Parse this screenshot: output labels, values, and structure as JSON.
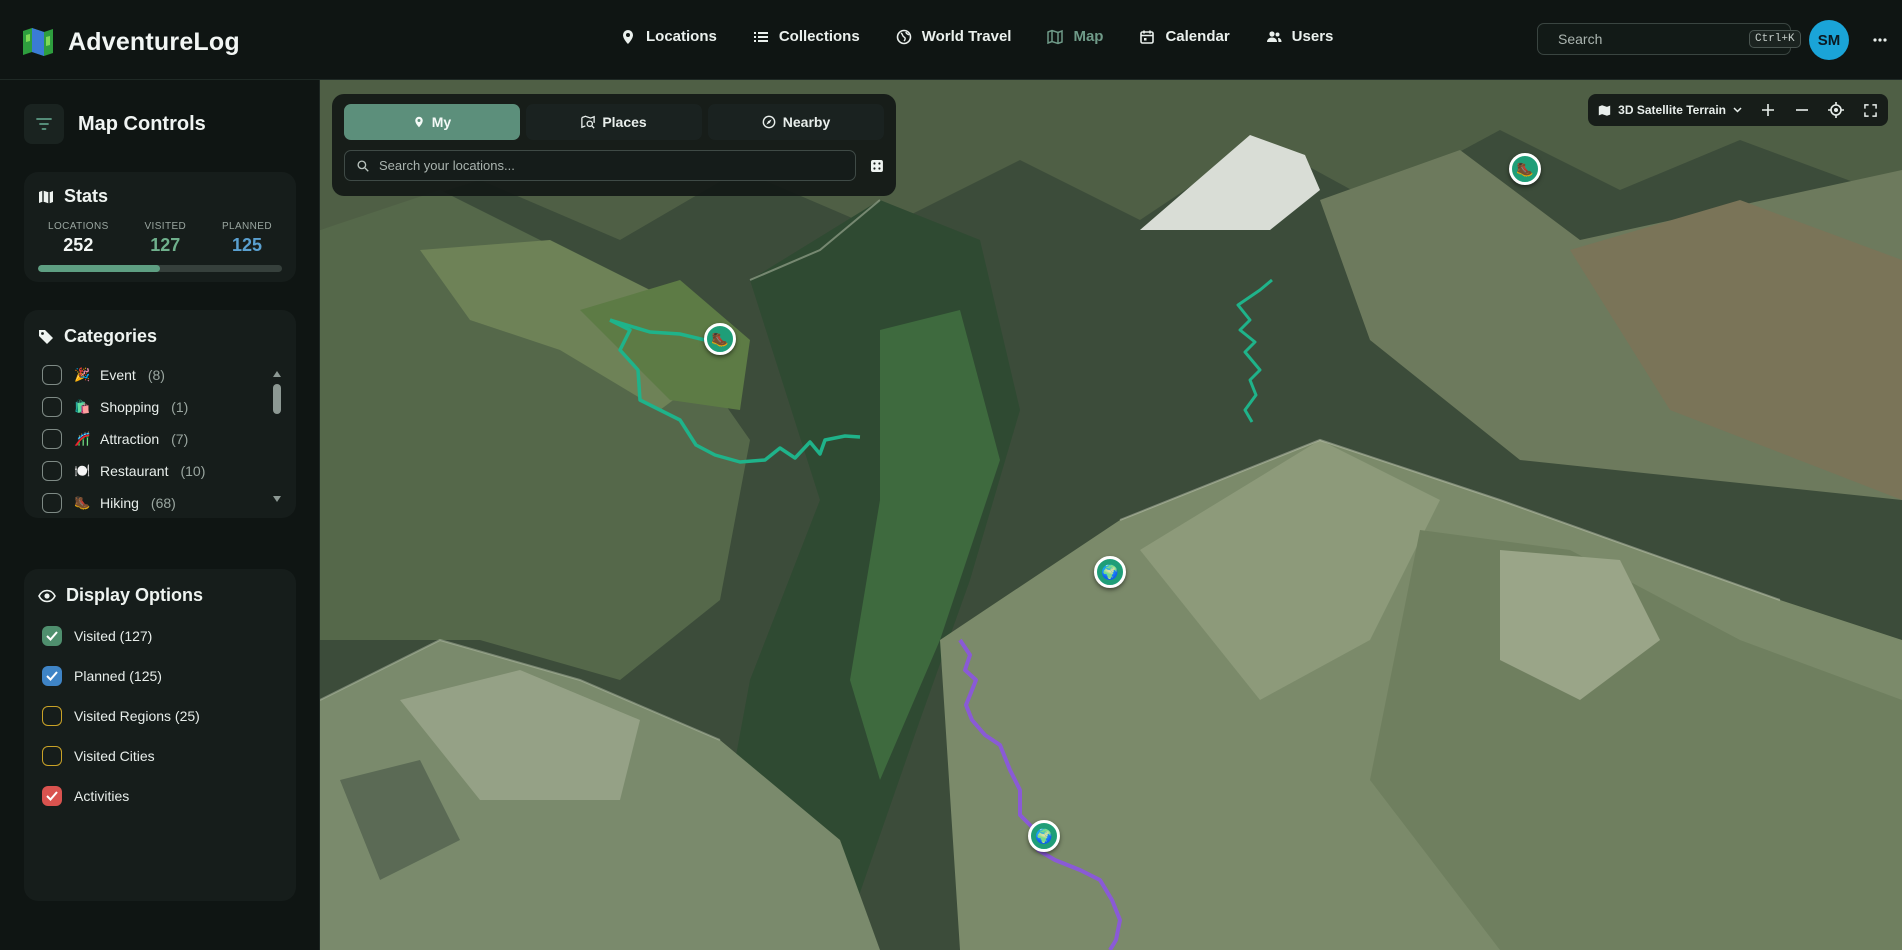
{
  "app": {
    "name": "AdventureLog"
  },
  "nav": {
    "items": [
      {
        "label": "Locations",
        "icon": "pin-icon",
        "active": false
      },
      {
        "label": "Collections",
        "icon": "list-icon",
        "active": false
      },
      {
        "label": "World Travel",
        "icon": "globe-icon",
        "active": false
      },
      {
        "label": "Map",
        "icon": "map-icon",
        "active": true
      },
      {
        "label": "Calendar",
        "icon": "calendar-icon",
        "active": false
      },
      {
        "label": "Users",
        "icon": "users-icon",
        "active": false
      }
    ]
  },
  "search": {
    "placeholder": "Search",
    "shortcut": "Ctrl+K"
  },
  "user": {
    "initials": "SM"
  },
  "sidebar": {
    "title": "Map Controls",
    "stats": {
      "title": "Stats",
      "locations_label": "LOCATIONS",
      "locations": "252",
      "visited_label": "VISITED",
      "visited": "127",
      "planned_label": "PLANNED",
      "planned": "125",
      "visited_fraction": 0.5
    },
    "categories": {
      "title": "Categories",
      "items": [
        {
          "emoji": "🎉",
          "label": "Event",
          "count": "(8)"
        },
        {
          "emoji": "🛍️",
          "label": "Shopping",
          "count": "(1)"
        },
        {
          "emoji": "🎢",
          "label": "Attraction",
          "count": "(7)"
        },
        {
          "emoji": "🍽️",
          "label": "Restaurant",
          "count": "(10)"
        },
        {
          "emoji": "🥾",
          "label": "Hiking",
          "count": "(68)"
        }
      ]
    },
    "display": {
      "title": "Display Options",
      "items": [
        {
          "label": "Visited (127)",
          "checked": true,
          "color": "#4f8f6e"
        },
        {
          "label": "Planned (125)",
          "checked": true,
          "color": "#3f84c6"
        },
        {
          "label": "Visited Regions (25)",
          "checked": false,
          "color": "#c9a227"
        },
        {
          "label": "Visited Cities",
          "checked": false,
          "color": "#c9a227"
        },
        {
          "label": "Activities",
          "checked": true,
          "color": "#d9534f"
        }
      ]
    }
  },
  "map": {
    "tabs": [
      {
        "label": "My",
        "icon": "pin-icon",
        "active": true
      },
      {
        "label": "Places",
        "icon": "map-search-icon",
        "active": false
      },
      {
        "label": "Nearby",
        "icon": "compass-icon",
        "active": false
      }
    ],
    "search_placeholder": "Search your locations...",
    "style_label": "3D Satellite Terrain"
  },
  "colors": {
    "accent": "#5c8f7b",
    "visited": "#6fb08c",
    "planned": "#5aa0d0",
    "trail_green": "#1fb38a",
    "trail_purple": "#8a5ad6"
  }
}
